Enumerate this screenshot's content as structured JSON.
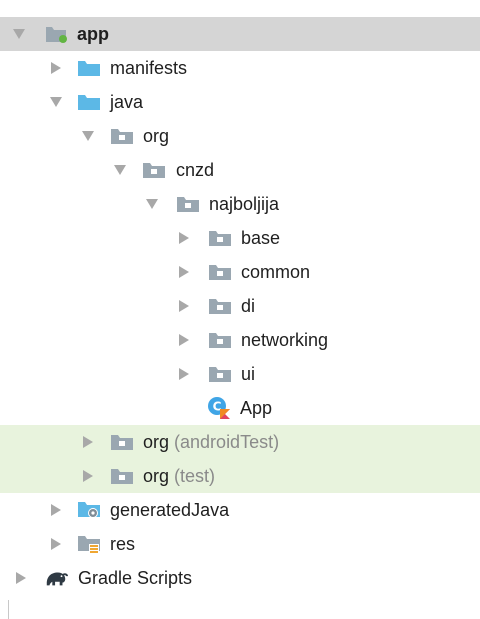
{
  "tree": {
    "app": {
      "label": "app"
    },
    "manifests": {
      "label": "manifests"
    },
    "java": {
      "label": "java"
    },
    "org": {
      "label": "org"
    },
    "cnzd": {
      "label": "cnzd"
    },
    "najboljija": {
      "label": "najboljija"
    },
    "base": {
      "label": "base"
    },
    "common": {
      "label": "common"
    },
    "di": {
      "label": "di"
    },
    "networking": {
      "label": "networking"
    },
    "ui": {
      "label": "ui"
    },
    "app_class": {
      "label": "App"
    },
    "org_android_test": {
      "label": "org",
      "suffix": "(androidTest)"
    },
    "org_test": {
      "label": "org",
      "suffix": "(test)"
    },
    "generated_java": {
      "label": "generatedJava"
    },
    "res": {
      "label": "res"
    },
    "gradle_scripts": {
      "label": "Gradle Scripts"
    }
  },
  "colors": {
    "selected_row": "#d5d5d5",
    "test_row": "#e8f3dd",
    "folder_blue": "#5cb8e6",
    "package_gray": "#9aa7b1",
    "arrow_gray": "#a8a8a8",
    "suffix_gray": "#8a8a8a"
  },
  "icons": {
    "module": "module-folder-icon",
    "source_folder": "source-folder-icon",
    "package": "package-icon",
    "kotlin_class": "kotlin-class-icon",
    "generated": "generated-folder-icon",
    "resources": "resources-folder-icon",
    "gradle": "gradle-elephant-icon"
  }
}
